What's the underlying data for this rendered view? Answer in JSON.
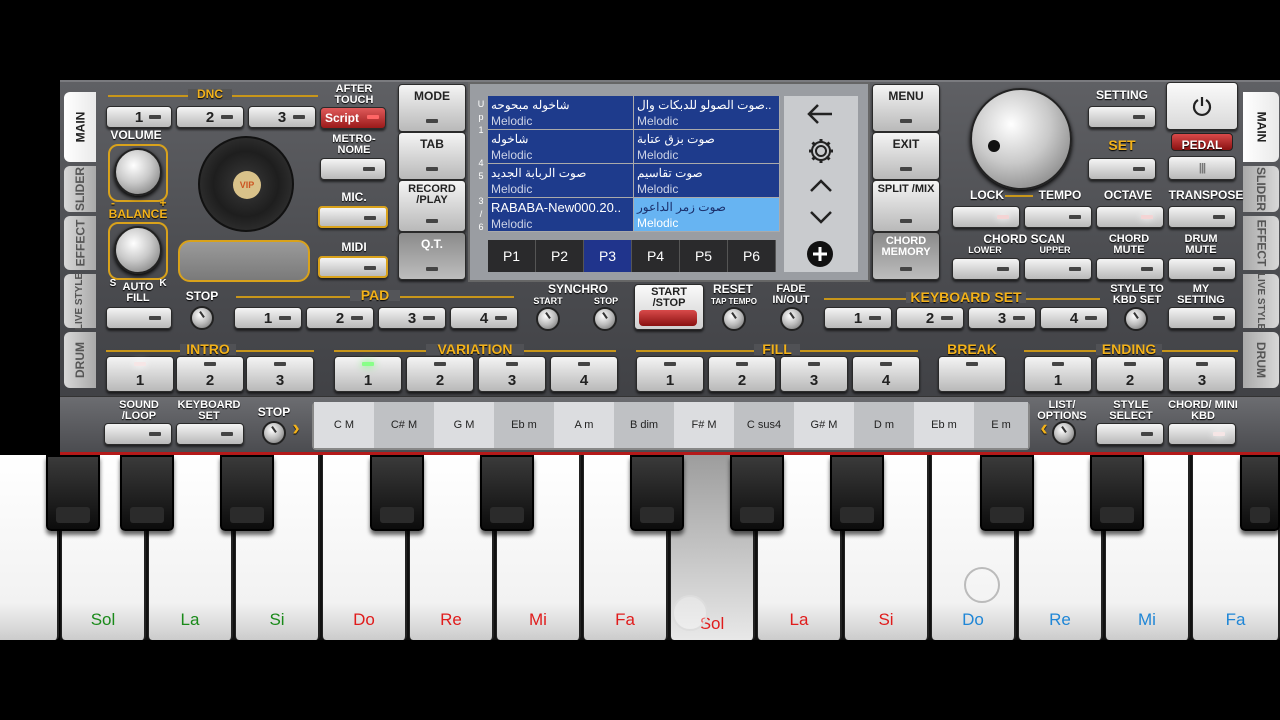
{
  "side_tabs_left": [
    "MAIN",
    "SLIDER",
    "EFFECT",
    "LIVE STYLE",
    "DRUM"
  ],
  "side_tabs_right": [
    "MAIN",
    "SLIDER",
    "EFFECT",
    "LIVE STYLE",
    "DRUM"
  ],
  "dnc": {
    "label": "DNC",
    "buttons": [
      "1",
      "2",
      "3"
    ]
  },
  "after_touch": {
    "label": "AFTER TOUCH",
    "button": "Script"
  },
  "volume": "VOLUME",
  "balance": "BALANCE",
  "balance_minus": "-",
  "balance_plus": "+",
  "balance_s": "S",
  "balance_k": "K",
  "vip_label": "VIP",
  "metronome": "METRO-NOME",
  "mic": "MIC.",
  "midi": "MIDI",
  "mode": "MODE",
  "tab": "TAB",
  "record_play": "RECORD /PLAY",
  "qt": "Q.T.",
  "screen": {
    "side_letters": [
      "U",
      "p",
      "1",
      "4",
      "5",
      "3",
      "/",
      "6"
    ],
    "rows": [
      {
        "left": {
          "name": "شاخوله مبحوحه",
          "type": "Melodic"
        },
        "right": {
          "name": "صوت الصولو للدبكات وال..",
          "type": "Melodic"
        }
      },
      {
        "left": {
          "name": "شاخوله",
          "type": "Melodic"
        },
        "right": {
          "name": "صوت بزق عتابة",
          "type": "Melodic"
        }
      },
      {
        "left": {
          "name": "صوت الربابة الجديد",
          "type": "Melodic"
        },
        "right": {
          "name": "صوت تقاسيم",
          "type": "Melodic"
        }
      },
      {
        "left": {
          "name": "RABABA-New000.20..",
          "type": "Melodic"
        },
        "right": {
          "name": "صوت زمر الداعور",
          "type": "Melodic"
        }
      }
    ],
    "pages": [
      "P1",
      "P2",
      "P3",
      "P4",
      "P5",
      "P6"
    ],
    "selected_page": "P3"
  },
  "menu": "MENU",
  "exit": "EXIT",
  "split_mix": "SPLIT /MIX",
  "chord_memory": "CHORD MEMORY",
  "setting": "SETTING",
  "set": "SET",
  "pedal": "PEDAL",
  "power_icon": "power-icon",
  "lock": "LOCK",
  "tempo": "TEMPO",
  "octave": "OCTAVE",
  "transpose": "TRANSPOSE",
  "chord_scan": "CHORD SCAN",
  "lower": "LOWER",
  "upper": "UPPER",
  "chord_mute": "CHORD MUTE",
  "drum_mute": "DRUM MUTE",
  "auto_fill": "AUTO FILL",
  "stop": "STOP",
  "pad": {
    "label": "PAD",
    "buttons": [
      "1",
      "2",
      "3",
      "4"
    ]
  },
  "synchro": {
    "label": "SYNCHRO",
    "start": "START",
    "stop": "STOP"
  },
  "start_stop": "START /STOP",
  "reset": "RESET",
  "tap_tempo": "TAP TEMPO",
  "fade": "FADE IN/OUT",
  "keyboard_set": {
    "label": "KEYBOARD SET",
    "buttons": [
      "1",
      "2",
      "3",
      "4"
    ]
  },
  "style_to_kbd": "STYLE TO KBD SET",
  "my_setting": "MY SETTING",
  "intro": {
    "label": "INTRO",
    "buttons": [
      "1",
      "2",
      "3"
    ]
  },
  "variation": {
    "label": "VARIATION",
    "buttons": [
      "1",
      "2",
      "3",
      "4"
    ]
  },
  "fill": {
    "label": "FILL",
    "buttons": [
      "1",
      "2",
      "3",
      "4"
    ]
  },
  "break": "BREAK",
  "ending": {
    "label": "ENDING",
    "buttons": [
      "1",
      "2",
      "3"
    ]
  },
  "sound_loop": "SOUND /LOOP",
  "keyboard_set2": "KEYBOARD SET",
  "stop2": "STOP",
  "chords": [
    "C M",
    "C# M",
    "G M",
    "Eb m",
    "A m",
    "B dim",
    "F# M",
    "C sus4",
    "G# M",
    "D m",
    "Eb m",
    "E m"
  ],
  "list_options": "LIST/ OPTIONS",
  "style_select": "STYLE SELECT",
  "chord_mini": "CHORD/ MINI KBD",
  "white_keys": [
    {
      "name": "Sol",
      "color": "#1a8a1a"
    },
    {
      "name": "La",
      "color": "#1a8a1a"
    },
    {
      "name": "Si",
      "color": "#1a8a1a"
    },
    {
      "name": "Do",
      "color": "#e01c1c"
    },
    {
      "name": "Re",
      "color": "#e01c1c"
    },
    {
      "name": "Mi",
      "color": "#e01c1c"
    },
    {
      "name": "Fa",
      "color": "#e01c1c"
    },
    {
      "name": "Sol",
      "color": "#e01c1c"
    },
    {
      "name": "La",
      "color": "#e01c1c"
    },
    {
      "name": "Si",
      "color": "#e01c1c"
    },
    {
      "name": "Do",
      "color": "#1f86d6"
    },
    {
      "name": "Re",
      "color": "#1f86d6"
    },
    {
      "name": "Mi",
      "color": "#1f86d6"
    },
    {
      "name": "Fa",
      "color": "#1f86d6"
    }
  ]
}
